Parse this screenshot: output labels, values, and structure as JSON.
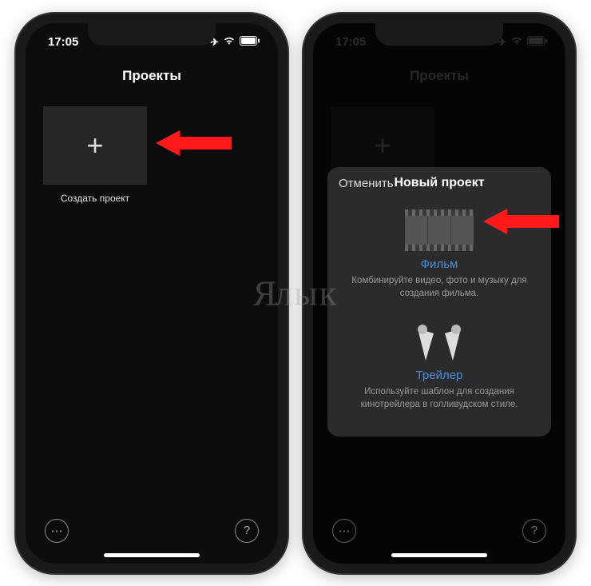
{
  "status": {
    "time": "17:05"
  },
  "nav": {
    "title": "Проекты"
  },
  "create": {
    "label": "Создать проект"
  },
  "sheet": {
    "cancel": "Отменить",
    "title": "Новый проект",
    "movie": {
      "title": "Фильм",
      "desc": "Комбинируйте видео, фото и музыку для создания фильма."
    },
    "trailer": {
      "title": "Трейлер",
      "desc": "Используйте шаблон для создания кинотрейлера в голливудском стиле."
    }
  },
  "watermark": {
    "left": "Я",
    "right": "лык"
  }
}
